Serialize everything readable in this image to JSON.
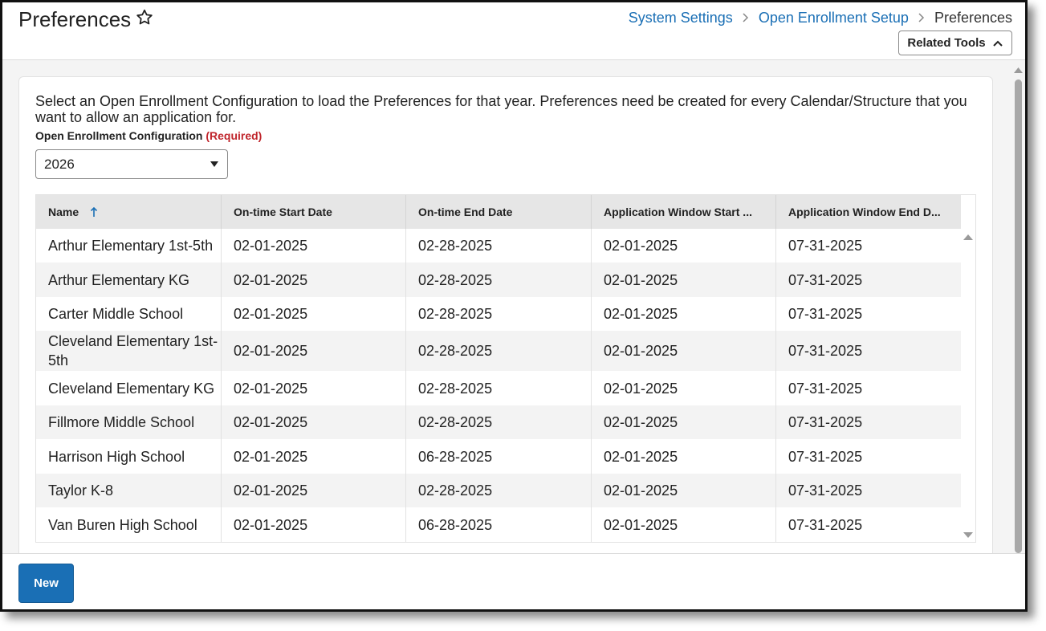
{
  "header": {
    "title": "Preferences",
    "breadcrumb": [
      "System Settings",
      "Open Enrollment Setup",
      "Preferences"
    ],
    "related_tools_label": "Related Tools"
  },
  "main": {
    "intro": "Select an Open Enrollment Configuration to load the Preferences for that year. Preferences need be created for every Calendar/Structure that you want to allow an application for.",
    "config_label": "Open Enrollment Configuration",
    "config_required": "(Required)",
    "config_value": "2026"
  },
  "table": {
    "columns": [
      "Name",
      "On-time Start Date",
      "On-time End Date",
      "Application Window Start ...",
      "Application Window End D..."
    ],
    "sort_column": "Name",
    "sort_direction": "ascending",
    "rows": [
      [
        "Arthur Elementary 1st-5th",
        "02-01-2025",
        "02-28-2025",
        "02-01-2025",
        "07-31-2025"
      ],
      [
        "Arthur Elementary KG",
        "02-01-2025",
        "02-28-2025",
        "02-01-2025",
        "07-31-2025"
      ],
      [
        "Carter Middle School",
        "02-01-2025",
        "02-28-2025",
        "02-01-2025",
        "07-31-2025"
      ],
      [
        "Cleveland Elementary 1st-5th",
        "02-01-2025",
        "02-28-2025",
        "02-01-2025",
        "07-31-2025"
      ],
      [
        "Cleveland Elementary KG",
        "02-01-2025",
        "02-28-2025",
        "02-01-2025",
        "07-31-2025"
      ],
      [
        "Fillmore Middle School",
        "02-01-2025",
        "02-28-2025",
        "02-01-2025",
        "07-31-2025"
      ],
      [
        "Harrison High School",
        "02-01-2025",
        "06-28-2025",
        "02-01-2025",
        "07-31-2025"
      ],
      [
        "Taylor K-8",
        "02-01-2025",
        "02-28-2025",
        "02-01-2025",
        "07-31-2025"
      ],
      [
        "Van Buren High School",
        "02-01-2025",
        "06-28-2025",
        "02-01-2025",
        "07-31-2025"
      ]
    ]
  },
  "footer": {
    "new_label": "New"
  },
  "colors": {
    "accent": "#1a6fb5",
    "required": "#c0262d",
    "header_bg": "#e6e6e6"
  }
}
